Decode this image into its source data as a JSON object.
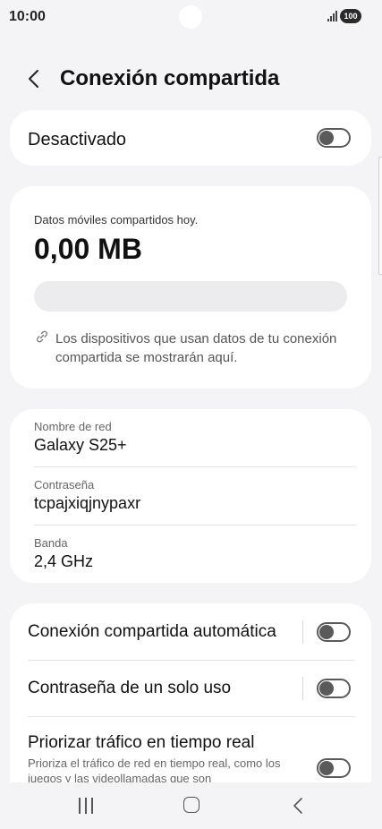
{
  "status_bar": {
    "time": "10:00",
    "battery": "100"
  },
  "header": {
    "title": "Conexión compartida"
  },
  "master": {
    "label": "Desactivado",
    "enabled": false
  },
  "usage": {
    "caption": "Datos móviles compartidos hoy.",
    "value": "0,00 MB",
    "fill_fraction": 0,
    "devices_note": "Los dispositivos que usan datos de tu conexión compartida se mostrarán aquí."
  },
  "network": {
    "name_label": "Nombre de red",
    "name_value": "Galaxy S25+",
    "password_label": "Contraseña",
    "password_value": "tcpajxiqjnypaxr",
    "band_label": "Banda",
    "band_value": "2,4 GHz"
  },
  "options": [
    {
      "label": "Conexión compartida automática",
      "enabled": false
    },
    {
      "label": "Contraseña de un solo uso",
      "enabled": false
    },
    {
      "label": "Priorizar tráfico en tiempo real",
      "sublabel": "Prioriza el tráfico de red en tiempo real, como los juegos y las videollamadas que son",
      "enabled": false
    }
  ],
  "colors": {
    "background": "#f4f4f6",
    "card": "#ffffff",
    "switch_off": "#5a5a5a"
  }
}
